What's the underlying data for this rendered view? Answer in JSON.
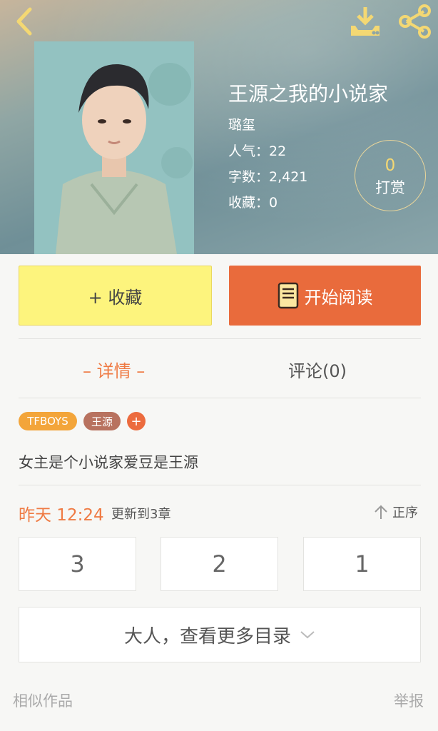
{
  "colors": {
    "accent": "#ef7a43",
    "read_button": "#e96b3c",
    "collect_button": "#fdf47d",
    "icon_gold": "#f4d873"
  },
  "book": {
    "title": "王源之我的小说家",
    "author": "璐玺",
    "popularity": "人气：22",
    "word_count": "字数：2,421",
    "favorites": "收藏：0"
  },
  "reward": {
    "count": "0",
    "label": "打赏"
  },
  "actions": {
    "collect_label": "+ 收藏",
    "read_label": "开始阅读"
  },
  "tabs": {
    "detail": "– 详情 –",
    "comment": "评论(0)"
  },
  "tags": [
    "TFBOYS",
    "王源"
  ],
  "tag_add": "+",
  "description": "女主是个小说家爱豆是王源",
  "update": {
    "time": "昨天 12:24",
    "text": "更新到3章",
    "sort_label": "正序"
  },
  "chapters": [
    "3",
    "2",
    "1"
  ],
  "more_catalog": "大人，查看更多目录",
  "footer": {
    "similar": "相似作品",
    "report": "举报"
  },
  "icons": [
    "back-arrow-icon",
    "download-icon",
    "share-icon",
    "book-icon",
    "sort-up-arrow-icon",
    "chevron-down-icon"
  ]
}
